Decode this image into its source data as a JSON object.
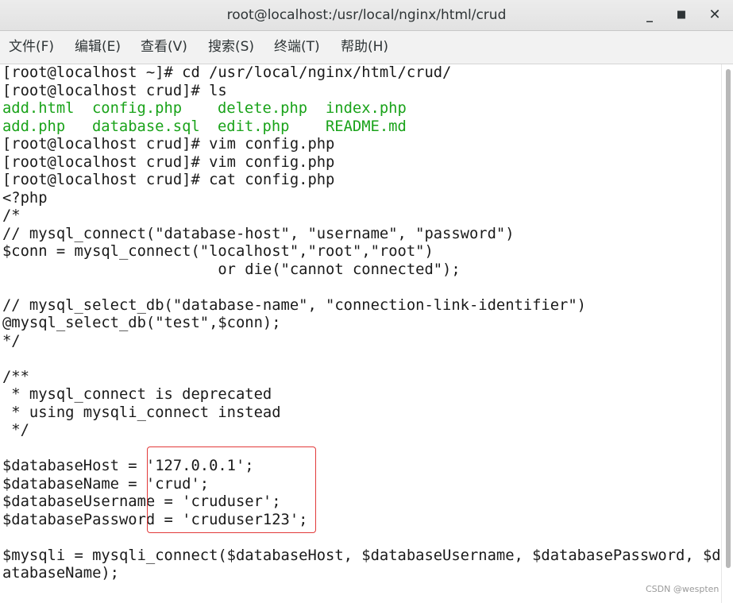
{
  "window": {
    "title": "root@localhost:/usr/local/nginx/html/crud",
    "minimize_glyph": "_",
    "maximize_glyph": "■",
    "close_glyph": "✕"
  },
  "menu": {
    "file": "文件(F)",
    "edit": "编辑(E)",
    "view": "查看(V)",
    "search": "搜索(S)",
    "terminal": "终端(T)",
    "help": "帮助(H)"
  },
  "terminal": {
    "colors": {
      "text": "#1a1a1a",
      "listing_green": "#1aa31a",
      "highlight_box": "#e23a3a"
    },
    "lines": [
      "[root@localhost ~]# cd /usr/local/nginx/html/crud/",
      "[root@localhost crud]# ls",
      "",
      "",
      "[root@localhost crud]# vim config.php",
      "[root@localhost crud]# vim config.php",
      "[root@localhost crud]# cat config.php",
      "<?php",
      "/*",
      "// mysql_connect(\"database-host\", \"username\", \"password\")",
      "$conn = mysql_connect(\"localhost\",\"root\",\"root\")",
      "                        or die(\"cannot connected\");",
      "",
      "// mysql_select_db(\"database-name\", \"connection-link-identifier\")",
      "@mysql_select_db(\"test\",$conn);",
      "*/",
      "",
      "/**",
      " * mysql_connect is deprecated",
      " * using mysqli_connect instead",
      " */",
      "",
      "$databaseHost = '127.0.0.1';",
      "$databaseName = 'crud';",
      "$databaseUsername = 'cruduser';",
      "$databasePassword = 'cruduser123';",
      "",
      "$mysqli = mysqli_connect($databaseHost, $databaseUsername, $databasePassword, $d",
      "atabaseName);"
    ],
    "ls_output": [
      [
        "add.html",
        "config.php",
        "delete.php",
        "index.php"
      ],
      [
        "add.php",
        "database.sql",
        "edit.php",
        "README.md"
      ]
    ]
  },
  "watermark": "CSDN @wespten"
}
